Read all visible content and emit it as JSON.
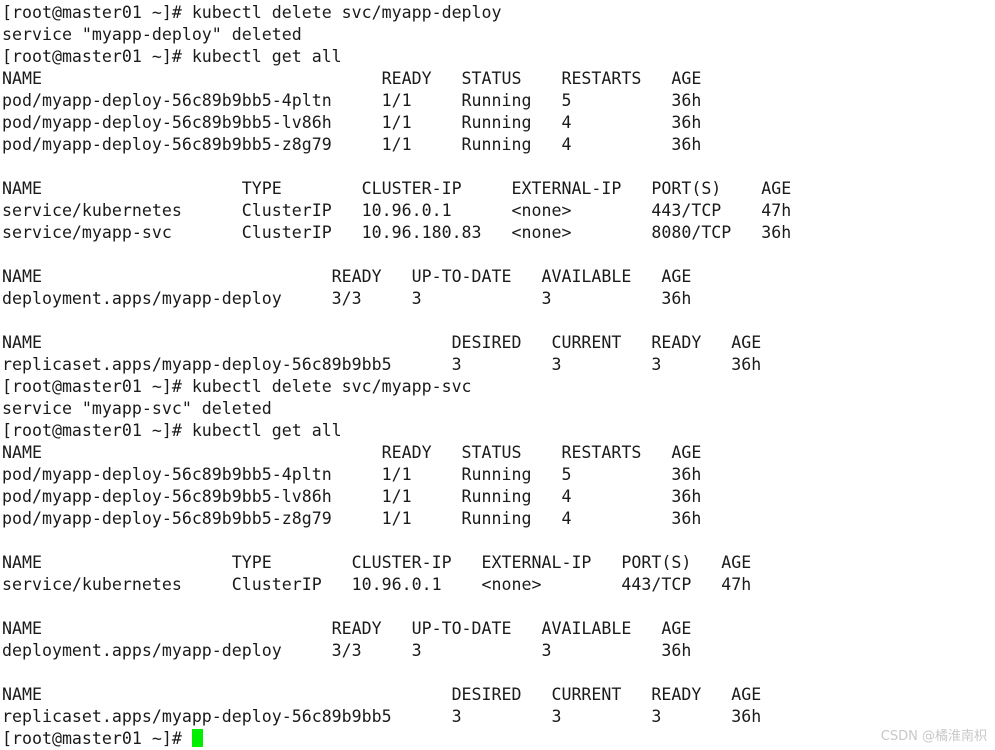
{
  "terminal": {
    "background_color": "#ffffff",
    "text_color": "#1a1a1a",
    "cursor_color": "#00ee00",
    "prompt": "[root@master01 ~]#",
    "lines": [
      "[root@master01 ~]# kubectl delete svc/myapp-deploy",
      "service \"myapp-deploy\" deleted",
      "[root@master01 ~]# kubectl get all",
      "NAME                                  READY   STATUS    RESTARTS   AGE",
      "pod/myapp-deploy-56c89b9bb5-4pltn     1/1     Running   5          36h",
      "pod/myapp-deploy-56c89b9bb5-lv86h     1/1     Running   4          36h",
      "pod/myapp-deploy-56c89b9bb5-z8g79     1/1     Running   4          36h",
      "",
      "NAME                    TYPE        CLUSTER-IP     EXTERNAL-IP   PORT(S)    AGE",
      "service/kubernetes      ClusterIP   10.96.0.1      <none>        443/TCP    47h",
      "service/myapp-svc       ClusterIP   10.96.180.83   <none>        8080/TCP   36h",
      "",
      "NAME                             READY   UP-TO-DATE   AVAILABLE   AGE",
      "deployment.apps/myapp-deploy     3/3     3            3           36h",
      "",
      "NAME                                         DESIRED   CURRENT   READY   AGE",
      "replicaset.apps/myapp-deploy-56c89b9bb5      3         3         3       36h",
      "[root@master01 ~]# kubectl delete svc/myapp-svc",
      "service \"myapp-svc\" deleted",
      "[root@master01 ~]# kubectl get all",
      "NAME                                  READY   STATUS    RESTARTS   AGE",
      "pod/myapp-deploy-56c89b9bb5-4pltn     1/1     Running   5          36h",
      "pod/myapp-deploy-56c89b9bb5-lv86h     1/1     Running   4          36h",
      "pod/myapp-deploy-56c89b9bb5-z8g79     1/1     Running   4          36h",
      "",
      "NAME                   TYPE        CLUSTER-IP   EXTERNAL-IP   PORT(S)   AGE",
      "service/kubernetes     ClusterIP   10.96.0.1    <none>        443/TCP   47h",
      "",
      "NAME                             READY   UP-TO-DATE   AVAILABLE   AGE",
      "deployment.apps/myapp-deploy     3/3     3            3           36h",
      "",
      "NAME                                         DESIRED   CURRENT   READY   AGE",
      "replicaset.apps/myapp-deploy-56c89b9bb5      3         3         3       36h"
    ],
    "final_prompt": "[root@master01 ~]# "
  },
  "commands": [
    "kubectl delete svc/myapp-deploy",
    "kubectl get all",
    "kubectl delete svc/myapp-svc",
    "kubectl get all"
  ],
  "resources": {
    "pods": {
      "headers": [
        "NAME",
        "READY",
        "STATUS",
        "RESTARTS",
        "AGE"
      ],
      "rows": [
        [
          "pod/myapp-deploy-56c89b9bb5-4pltn",
          "1/1",
          "Running",
          "5",
          "36h"
        ],
        [
          "pod/myapp-deploy-56c89b9bb5-lv86h",
          "1/1",
          "Running",
          "4",
          "36h"
        ],
        [
          "pod/myapp-deploy-56c89b9bb5-z8g79",
          "1/1",
          "Running",
          "4",
          "36h"
        ]
      ]
    },
    "services_before": {
      "headers": [
        "NAME",
        "TYPE",
        "CLUSTER-IP",
        "EXTERNAL-IP",
        "PORT(S)",
        "AGE"
      ],
      "rows": [
        [
          "service/kubernetes",
          "ClusterIP",
          "10.96.0.1",
          "<none>",
          "443/TCP",
          "47h"
        ],
        [
          "service/myapp-svc",
          "ClusterIP",
          "10.96.180.83",
          "<none>",
          "8080/TCP",
          "36h"
        ]
      ]
    },
    "services_after": {
      "headers": [
        "NAME",
        "TYPE",
        "CLUSTER-IP",
        "EXTERNAL-IP",
        "PORT(S)",
        "AGE"
      ],
      "rows": [
        [
          "service/kubernetes",
          "ClusterIP",
          "10.96.0.1",
          "<none>",
          "443/TCP",
          "47h"
        ]
      ]
    },
    "deployments": {
      "headers": [
        "NAME",
        "READY",
        "UP-TO-DATE",
        "AVAILABLE",
        "AGE"
      ],
      "rows": [
        [
          "deployment.apps/myapp-deploy",
          "3/3",
          "3",
          "3",
          "36h"
        ]
      ]
    },
    "replicasets": {
      "headers": [
        "NAME",
        "DESIRED",
        "CURRENT",
        "READY",
        "AGE"
      ],
      "rows": [
        [
          "replicaset.apps/myapp-deploy-56c89b9bb5",
          "3",
          "3",
          "3",
          "36h"
        ]
      ]
    }
  },
  "messages": [
    "service \"myapp-deploy\" deleted",
    "service \"myapp-svc\" deleted"
  ],
  "watermark": {
    "text": "CSDN @橘淮南枳",
    "color": "#c8c8c8"
  }
}
